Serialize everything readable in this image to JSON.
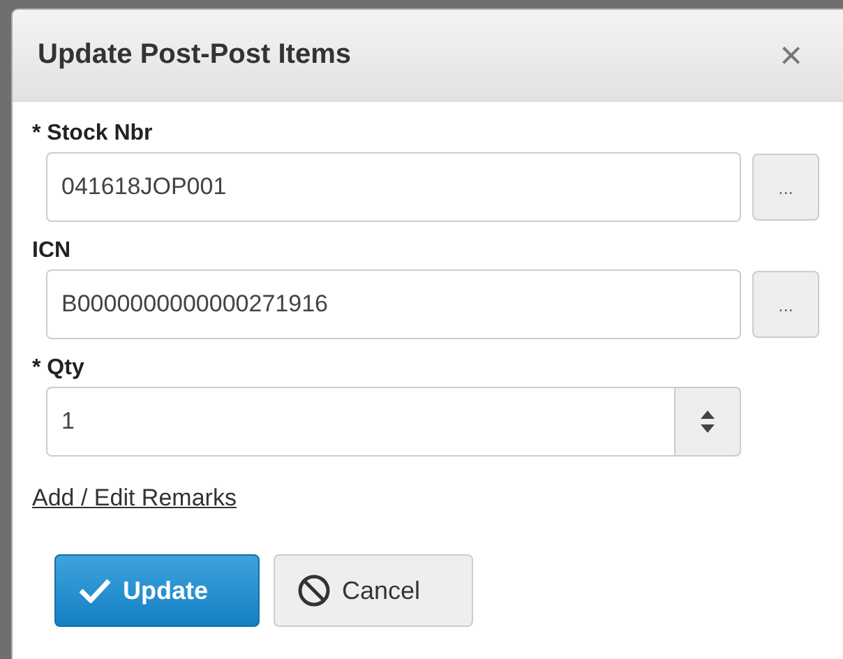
{
  "dialog": {
    "title": "Update Post-Post Items",
    "close": "×"
  },
  "fields": [
    {
      "kind": "lookup",
      "label": "* Stock Nbr",
      "value": "041618JOP001",
      "button": "..."
    },
    {
      "kind": "lookup",
      "label": "ICN",
      "value": "B0000000000000271916",
      "button": "..."
    },
    {
      "kind": "spinner",
      "label": "* Qty",
      "value": "1"
    }
  ],
  "link": "Add / Edit Remarks",
  "buttons": [
    {
      "kind": "primary",
      "label": "Update"
    },
    {
      "kind": "cancel",
      "label": "Cancel"
    }
  ]
}
